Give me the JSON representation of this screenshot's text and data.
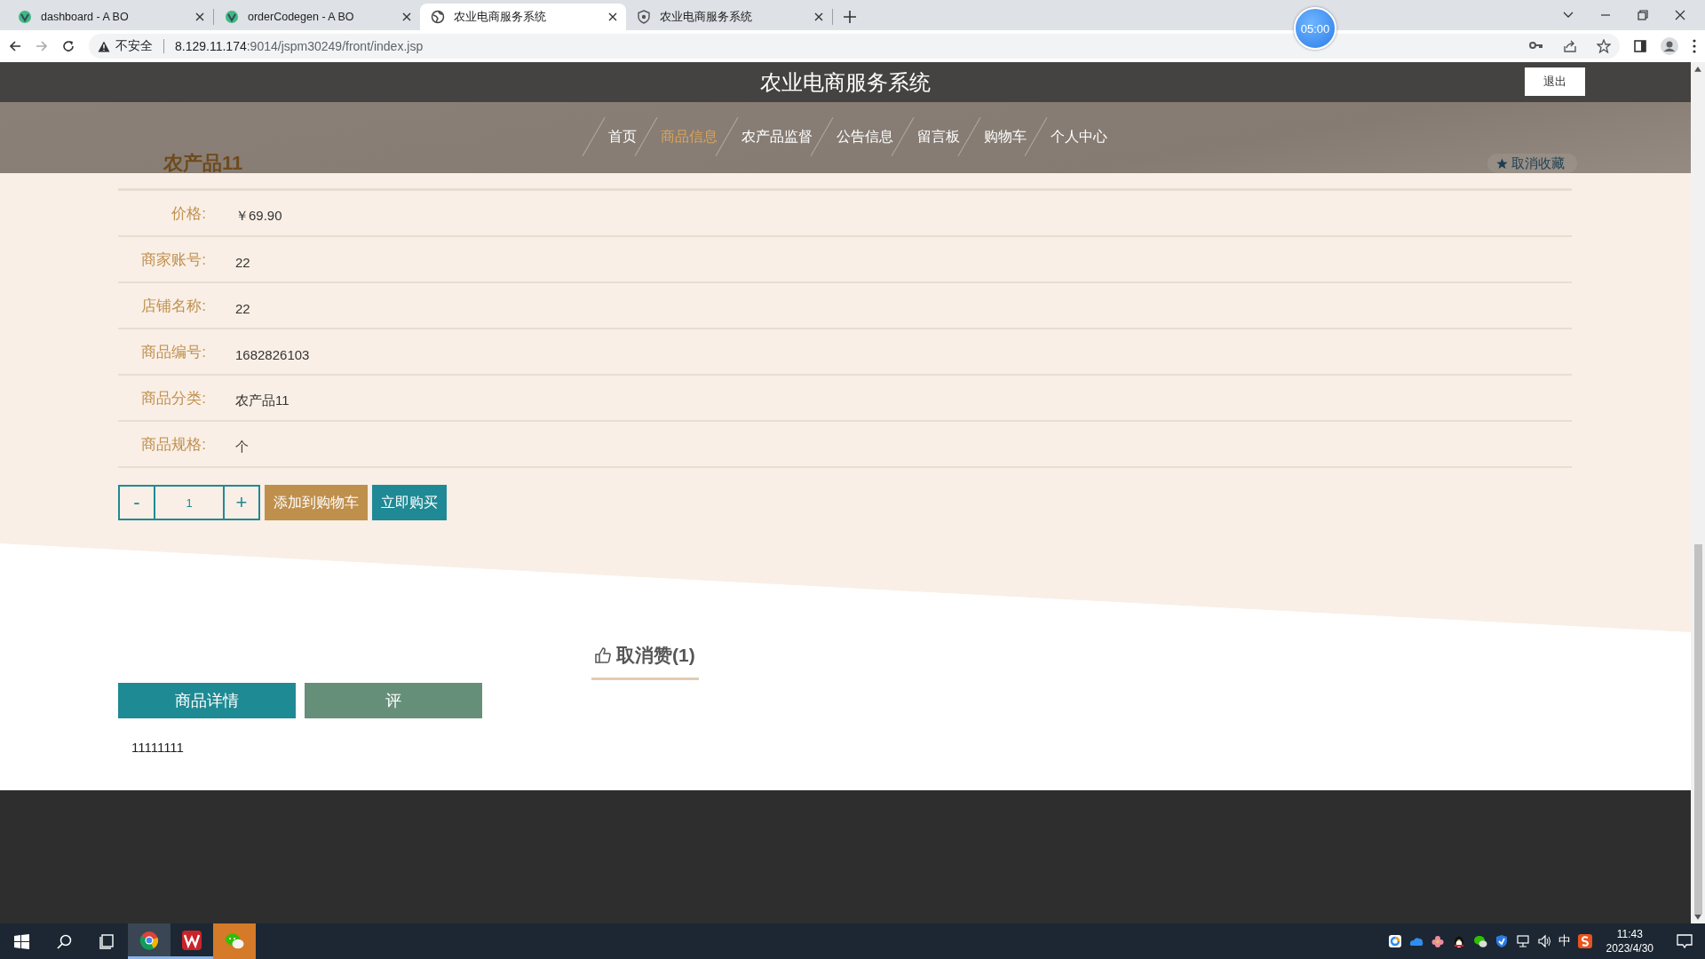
{
  "browser": {
    "tabs": [
      {
        "title": "dashboard - A BO",
        "kind": "vue",
        "selected": false
      },
      {
        "title": "orderCodegen - A BO",
        "kind": "vue",
        "selected": false
      },
      {
        "title": "农业电商服务系统",
        "kind": "globe",
        "selected": true
      },
      {
        "title": "农业电商服务系统",
        "kind": "shield",
        "selected": false
      }
    ],
    "security": "不安全",
    "url_host": "8.129.11.174",
    "url_rest": ":9014/jspm30249/front/index.jsp",
    "timer": "05:00"
  },
  "header": {
    "title": "农业电商服务系统",
    "logout": "退出"
  },
  "nav": [
    {
      "label": "首页",
      "selected": false
    },
    {
      "label": "商品信息",
      "selected": true
    },
    {
      "label": "农产品监督",
      "selected": false
    },
    {
      "label": "公告信息",
      "selected": false
    },
    {
      "label": "留言板",
      "selected": false
    },
    {
      "label": "购物车",
      "selected": false
    },
    {
      "label": "个人中心",
      "selected": false
    }
  ],
  "product": {
    "title": "农产品11",
    "favorite": "取消收藏",
    "fields": [
      {
        "label": "价格:",
        "value": "￥69.90"
      },
      {
        "label": "商家账号:",
        "value": "22"
      },
      {
        "label": "店铺名称:",
        "value": "22"
      },
      {
        "label": "商品编号:",
        "value": "1682826103"
      },
      {
        "label": "商品分类:",
        "value": "农产品11"
      },
      {
        "label": "商品规格:",
        "value": "个"
      }
    ],
    "minus": "-",
    "quantity": "1",
    "plus": "+",
    "add_to_cart": "添加到购物车",
    "buy_now": "立即购买"
  },
  "like": {
    "label": "取消赞(1)"
  },
  "detail_tabs": [
    {
      "label": "商品详情",
      "selected": true
    },
    {
      "label": "评",
      "selected": false
    }
  ],
  "detail_text": "11111111",
  "taskbar": {
    "apps": [
      {
        "kind": "chrome",
        "active": true,
        "flashing": false
      },
      {
        "kind": "wps",
        "active": false,
        "flashing": false
      },
      {
        "kind": "wechat",
        "active": false,
        "flashing": true
      }
    ],
    "ime": "中",
    "time": "11:43",
    "date": "2023/4/30"
  }
}
